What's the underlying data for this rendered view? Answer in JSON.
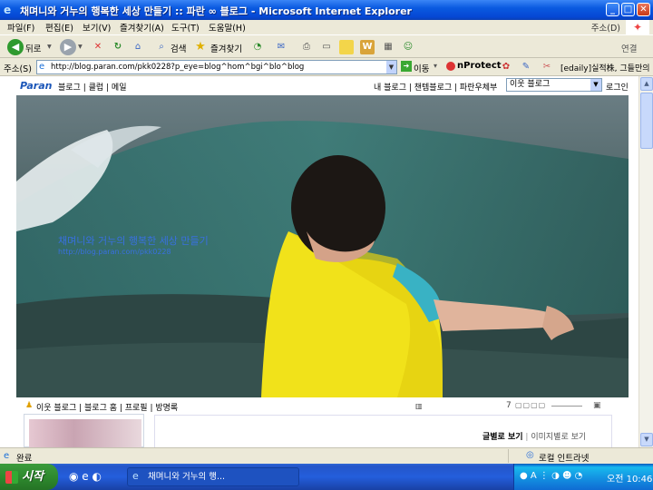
{
  "window": {
    "title": "채며니와 거누의 행복한 세상 만들기 :: 파란 ∞ 블로그 - Microsoft Internet Explorer",
    "minimize_label": "_",
    "maximize_label": "□",
    "close_label": "✕"
  },
  "menu": {
    "items": [
      "파일(F)",
      "편집(E)",
      "보기(V)",
      "즐겨찾기(A)",
      "도구(T)",
      "도움말(H)"
    ],
    "right_label": "주소(D)"
  },
  "toolbar": {
    "back_label": "뒤로",
    "search_label": "검색",
    "favorites_label": "즐겨찾기",
    "links_label": "연결"
  },
  "address": {
    "label": "주소(S)",
    "url": "http://blog.paran.com/pkk0228?p_eye=blog^hom^bgi^blo^blog",
    "go_label": "이동",
    "nprotect_label": "nProtect",
    "edaily_label": "[edaily]실적株, 그들만의"
  },
  "paran": {
    "logo": "Paran",
    "links": "블로그 | 클럽 | 메일",
    "right_links": "내 블로그 | 챈템블로그 | 파란우체부",
    "neighbor_select": "이웃 블로그",
    "login_label": "로그인"
  },
  "blog": {
    "title": "채며니와 거누의 행복한 세상 만들기",
    "url": "http://blog.paran.com/pkk0228",
    "nav": "이웃 블로그 | 블로그 홈 | 프로필 | 방명록",
    "page_controls": "7",
    "view_by_text": "글별로 보기",
    "view_by_image": "이미지별로 보기"
  },
  "status": {
    "text": "완료",
    "zone": "로컬 인트라넷"
  },
  "taskbar": {
    "start_label": "시작",
    "task_title": "채며니와 거누의 행...",
    "clock": "오전 10:46"
  }
}
